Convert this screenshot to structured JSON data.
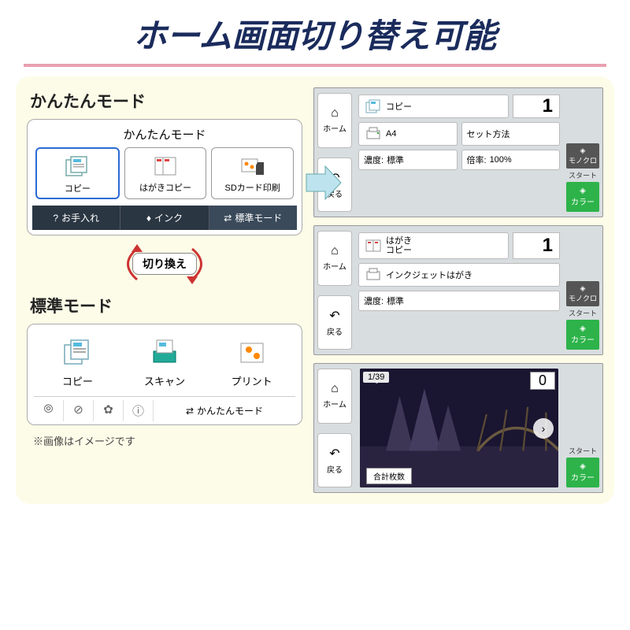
{
  "title": "ホーム画面切り替え可能",
  "simple": {
    "label": "かんたんモード",
    "head": "かんたんモード",
    "tiles": [
      "コピー",
      "はがきコピー",
      "SDカード印刷"
    ],
    "tabs": [
      "お手入れ",
      "インク",
      "標準モード"
    ]
  },
  "swap": "切り換え",
  "standard": {
    "label": "標準モード",
    "tiles": [
      "コピー",
      "スキャン",
      "プリント"
    ],
    "foot_mode": "かんたんモード"
  },
  "screens": {
    "side_home": "ホーム",
    "side_back": "戻る",
    "mono": "モノクロ",
    "start": "スタート",
    "color": "カラー",
    "copy": {
      "title": "コピー",
      "count": "1",
      "paper": "A4",
      "set": "セット方法",
      "density_lbl": "濃度:",
      "density_val": "標準",
      "ratio_lbl": "倍率:",
      "ratio_val": "100%"
    },
    "hagaki": {
      "title_l1": "はがき",
      "title_l2": "コピー",
      "count": "1",
      "media": "インクジェットはがき",
      "density_lbl": "濃度:",
      "density_val": "標準"
    },
    "photo": {
      "pager": "1/39",
      "count": "0",
      "total": "合計枚数"
    }
  },
  "footnote": "※画像はイメージです"
}
